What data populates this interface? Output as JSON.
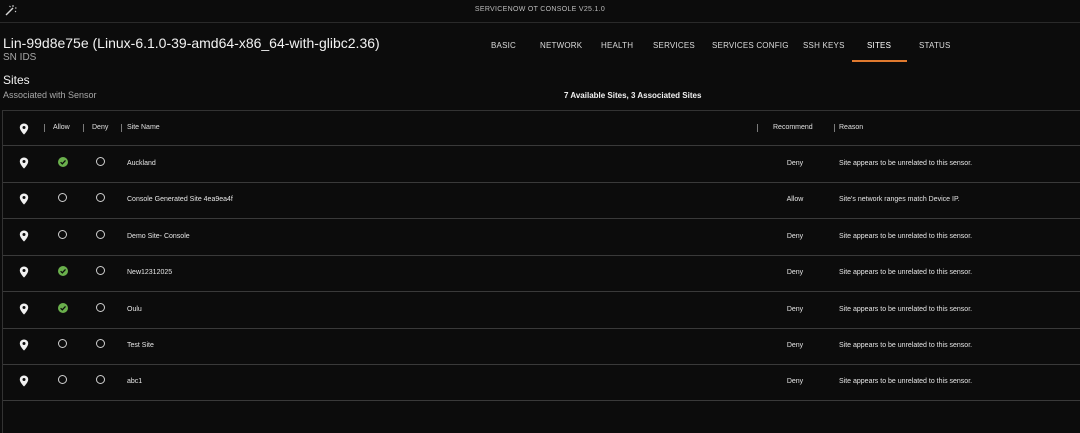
{
  "app": {
    "title": "SERVICENOW OT CONSOLE V25.1.0"
  },
  "header": {
    "host": "Lin-99d8e75e (Linux-6.1.0-39-amd64-x86_64-with-glibc2.36)",
    "subtitle": "SN IDS"
  },
  "tabs": [
    {
      "label": "BASIC"
    },
    {
      "label": "NETWORK"
    },
    {
      "label": "HEALTH"
    },
    {
      "label": "SERVICES"
    },
    {
      "label": "SERVICES CONFIG"
    },
    {
      "label": "SSH KEYS"
    },
    {
      "label": "SITES",
      "active": true
    },
    {
      "label": "STATUS"
    }
  ],
  "section": {
    "title": "Sites",
    "subtitle": "Associated with Sensor",
    "summary": "7 Available Sites, 3 Associated Sites"
  },
  "table": {
    "headers": {
      "allow": "Allow",
      "deny": "Deny",
      "site_name": "Site Name",
      "recommend": "Recommend",
      "reason": "Reason"
    },
    "rows": [
      {
        "site": "Auckland",
        "allowed": true,
        "recommend": "Deny",
        "reason": "Site appears to be unrelated to this sensor."
      },
      {
        "site": "Console Generated Site 4ea9ea4f",
        "allowed": false,
        "recommend": "Allow",
        "reason": "Site's network ranges match Device IP."
      },
      {
        "site": "Demo Site- Console",
        "allowed": false,
        "recommend": "Deny",
        "reason": "Site appears to be unrelated to this sensor."
      },
      {
        "site": "New12312025",
        "allowed": true,
        "recommend": "Deny",
        "reason": "Site appears to be unrelated to this sensor."
      },
      {
        "site": "Oulu",
        "allowed": true,
        "recommend": "Deny",
        "reason": "Site appears to be unrelated to this sensor."
      },
      {
        "site": "Test Site",
        "allowed": false,
        "recommend": "Deny",
        "reason": "Site appears to be unrelated to this sensor."
      },
      {
        "site": "abc1",
        "allowed": false,
        "recommend": "Deny",
        "reason": "Site appears to be unrelated to this sensor."
      }
    ]
  },
  "colors": {
    "accent": "#e07a2f",
    "allowed_check": "#6ab04c",
    "background": "#0c0c0c"
  },
  "icons": {
    "top_left": "magic-wand-icon",
    "location": "location-pin-icon",
    "selected": "check-circle-icon",
    "unselected": "radio-empty-icon"
  }
}
